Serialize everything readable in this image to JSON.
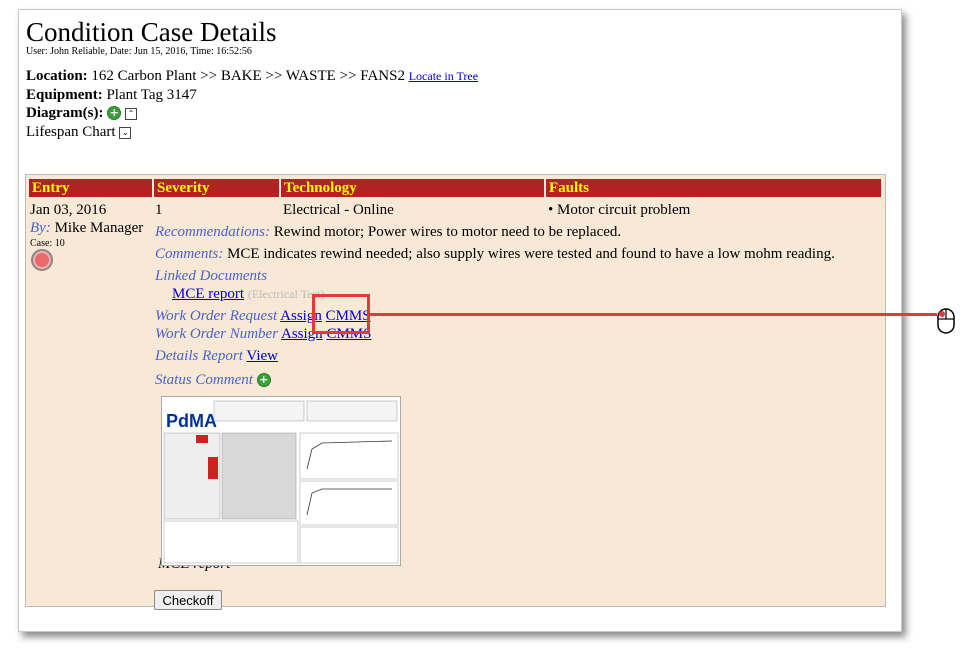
{
  "title": "Condition Case Details",
  "user_line": "User: John Reliable, Date: Jun 15, 2016, Time: 16:52:56",
  "location": {
    "label": "Location:",
    "value": "162 Carbon Plant >> BAKE >> WASTE >> FANS2",
    "link": "Locate in Tree"
  },
  "equipment": {
    "label": "Equipment:",
    "value": "Plant Tag 3147"
  },
  "diagrams": {
    "label": "Diagram(s):"
  },
  "lifespan": {
    "label": "Lifespan Chart"
  },
  "table": {
    "headers": [
      "Entry",
      "Severity",
      "Technology",
      "Faults"
    ],
    "entry_date": "Jan 03, 2016",
    "by_label": "By:",
    "by_name": "Mike Manager",
    "case": "Case: 10",
    "severity": "1",
    "technology": "Electrical - Online",
    "fault": "• Motor circuit problem",
    "recommendations_label": "Recommendations:",
    "recommendations": "Rewind motor; Power wires to motor need to be replaced.",
    "comments_label": "Comments:",
    "comments": "MCE indicates rewind needed; also supply wires were tested and found to have a low mohm reading.",
    "linked_docs_label": "Linked Documents",
    "doc_link": "MCE report",
    "doc_type": "(Electrical Test)",
    "wo_request_label": "Work Order Request",
    "wo_number_label": "Work Order Number",
    "assign": "Assign",
    "cmms": "CMMS",
    "details_label": "Details Report",
    "view": "View",
    "status_label": "Status Comment",
    "thumb_caption": "MCE report",
    "thumb_logo": "PdMA",
    "checkoff": "Checkoff"
  },
  "colors": {
    "header_bg": "#b22222",
    "header_text": "#ffff00",
    "panel_bg": "#f8e8d6",
    "highlight": "#e03a3a"
  }
}
